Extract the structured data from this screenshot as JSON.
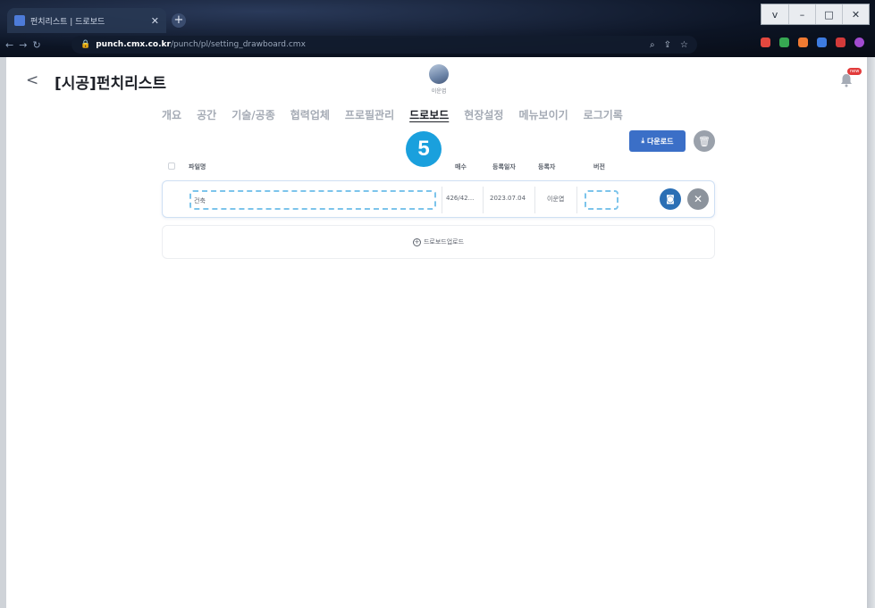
{
  "browser": {
    "tab_title": "펀치리스트 | 드로보드",
    "new_tab": "+",
    "url_host": "punch.cmx.co.kr",
    "url_path": "/punch/pl/setting_drawboard.cmx",
    "window_buttons": [
      "v",
      "–",
      "□",
      "✕"
    ]
  },
  "header": {
    "back": "<",
    "title": "[시공]펀치리스트",
    "user_name": "이운엽",
    "notification_badge": "new"
  },
  "tabs": [
    {
      "label": "개요",
      "active": false
    },
    {
      "label": "공간",
      "active": false
    },
    {
      "label": "기술/공종",
      "active": false
    },
    {
      "label": "협력업체",
      "active": false
    },
    {
      "label": "프로필관리",
      "active": false
    },
    {
      "label": "드로보드",
      "active": true
    },
    {
      "label": "현장설정",
      "active": false
    },
    {
      "label": "메뉴보이기",
      "active": false
    },
    {
      "label": "로그기록",
      "active": false
    }
  ],
  "toolbar": {
    "download_label": "다운로드",
    "download_icon": "download-icon",
    "trash_icon": "trash-icon"
  },
  "step_badge": "5",
  "table": {
    "headers": {
      "filename": "파일명",
      "pages": "매수",
      "date": "등록일자",
      "registrant": "등록자",
      "version": "버전"
    },
    "rows": [
      {
        "filename": "건축",
        "pages": "426/42...",
        "date": "2023.07.04",
        "registrant": "이운엽",
        "version": ""
      }
    ]
  },
  "upload": {
    "label": "드로보드업로드"
  },
  "colors": {
    "accent": "#3b6fc7",
    "step_badge": "#1aa0dd",
    "highlight_dash": "#7cc4eb"
  }
}
